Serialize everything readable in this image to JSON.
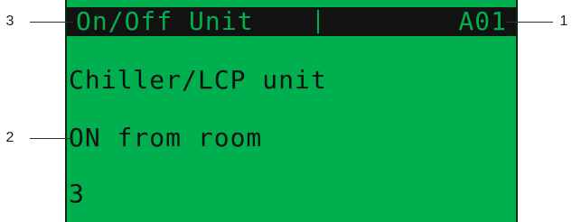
{
  "lcd": {
    "header": {
      "title": "On/Off Unit",
      "code": "A01"
    },
    "lines": [
      "Chiller/LCP unit",
      "ON from room",
      "3"
    ]
  },
  "callouts": [
    {
      "label": "1"
    },
    {
      "label": "2"
    },
    {
      "label": "3"
    }
  ],
  "colors": {
    "lcd_background": "#00b04f",
    "lcd_text": "#121212",
    "header_background": "#121212",
    "header_text": "#00b04f"
  }
}
